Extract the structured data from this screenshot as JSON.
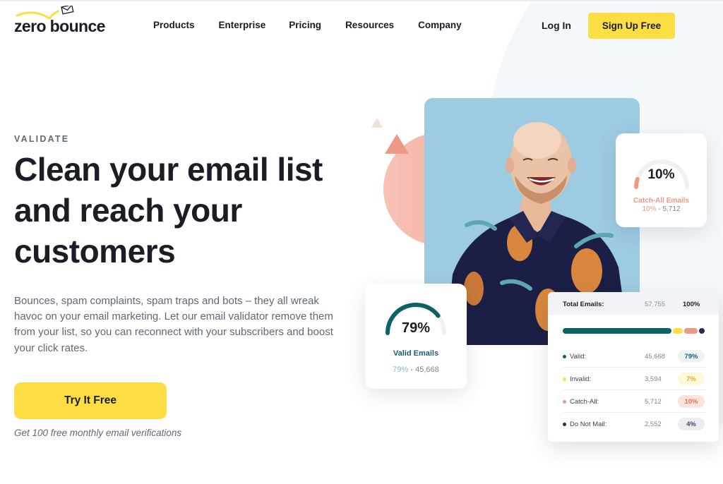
{
  "brand": {
    "name": "zero bounce",
    "accent": "#fcdd43",
    "dark": "#1a1d26"
  },
  "nav": {
    "items": [
      {
        "label": "Products"
      },
      {
        "label": "Enterprise"
      },
      {
        "label": "Pricing"
      },
      {
        "label": "Resources"
      },
      {
        "label": "Company"
      }
    ],
    "login_label": "Log In",
    "signup_label": "Sign Up Free"
  },
  "hero": {
    "eyebrow": "VALIDATE",
    "headline": "Clean your email list and reach your customers",
    "description": "Bounces, spam complaints, spam traps and bots – they all wreak havoc on your email marketing. Let our email validator remove them from your list, so you can reconnect with your subscribers and boost your click rates.",
    "cta_label": "Try It Free",
    "cta_note": "Get 100 free monthly email verifications"
  },
  "gauges": {
    "catch_all": {
      "value_label": "10%",
      "percent": 10,
      "title": "Catch-All Emails",
      "sub_pct": "10%",
      "sub_sep": " - ",
      "sub_count": "5,712",
      "color": "#ec9a83"
    },
    "valid": {
      "value_label": "79%",
      "percent": 79,
      "title": "Valid Emails",
      "sub_pct": "79%",
      "sub_sep": " - ",
      "sub_count": "45,668",
      "color": "#0b6463"
    }
  },
  "stats": {
    "total_label": "Total Emails:",
    "total_count": "57,755",
    "total_pct": "100%",
    "rows": [
      {
        "label": "Valid:",
        "count": "45,668",
        "pct": "79%",
        "percent": 79,
        "color": "#0b6463",
        "pill_bg": "#eef3f6",
        "pill_fg": "#1e5a7a"
      },
      {
        "label": "Invalid:",
        "count": "3,594",
        "pct": "7%",
        "percent": 7,
        "color": "#fcdd43",
        "pill_bg": "#fff8d9",
        "pill_fg": "#e8a92a"
      },
      {
        "label": "Catch-All:",
        "count": "5,712",
        "pct": "10%",
        "percent": 10,
        "color": "#ec9a83",
        "pill_bg": "#fbe3dc",
        "pill_fg": "#e0735a"
      },
      {
        "label": "Do Not Mail:",
        "count": "2,552",
        "pct": "4%",
        "percent": 4,
        "color": "#2e2a48",
        "pill_bg": "#ecedf0",
        "pill_fg": "#4a3f6b"
      }
    ]
  }
}
